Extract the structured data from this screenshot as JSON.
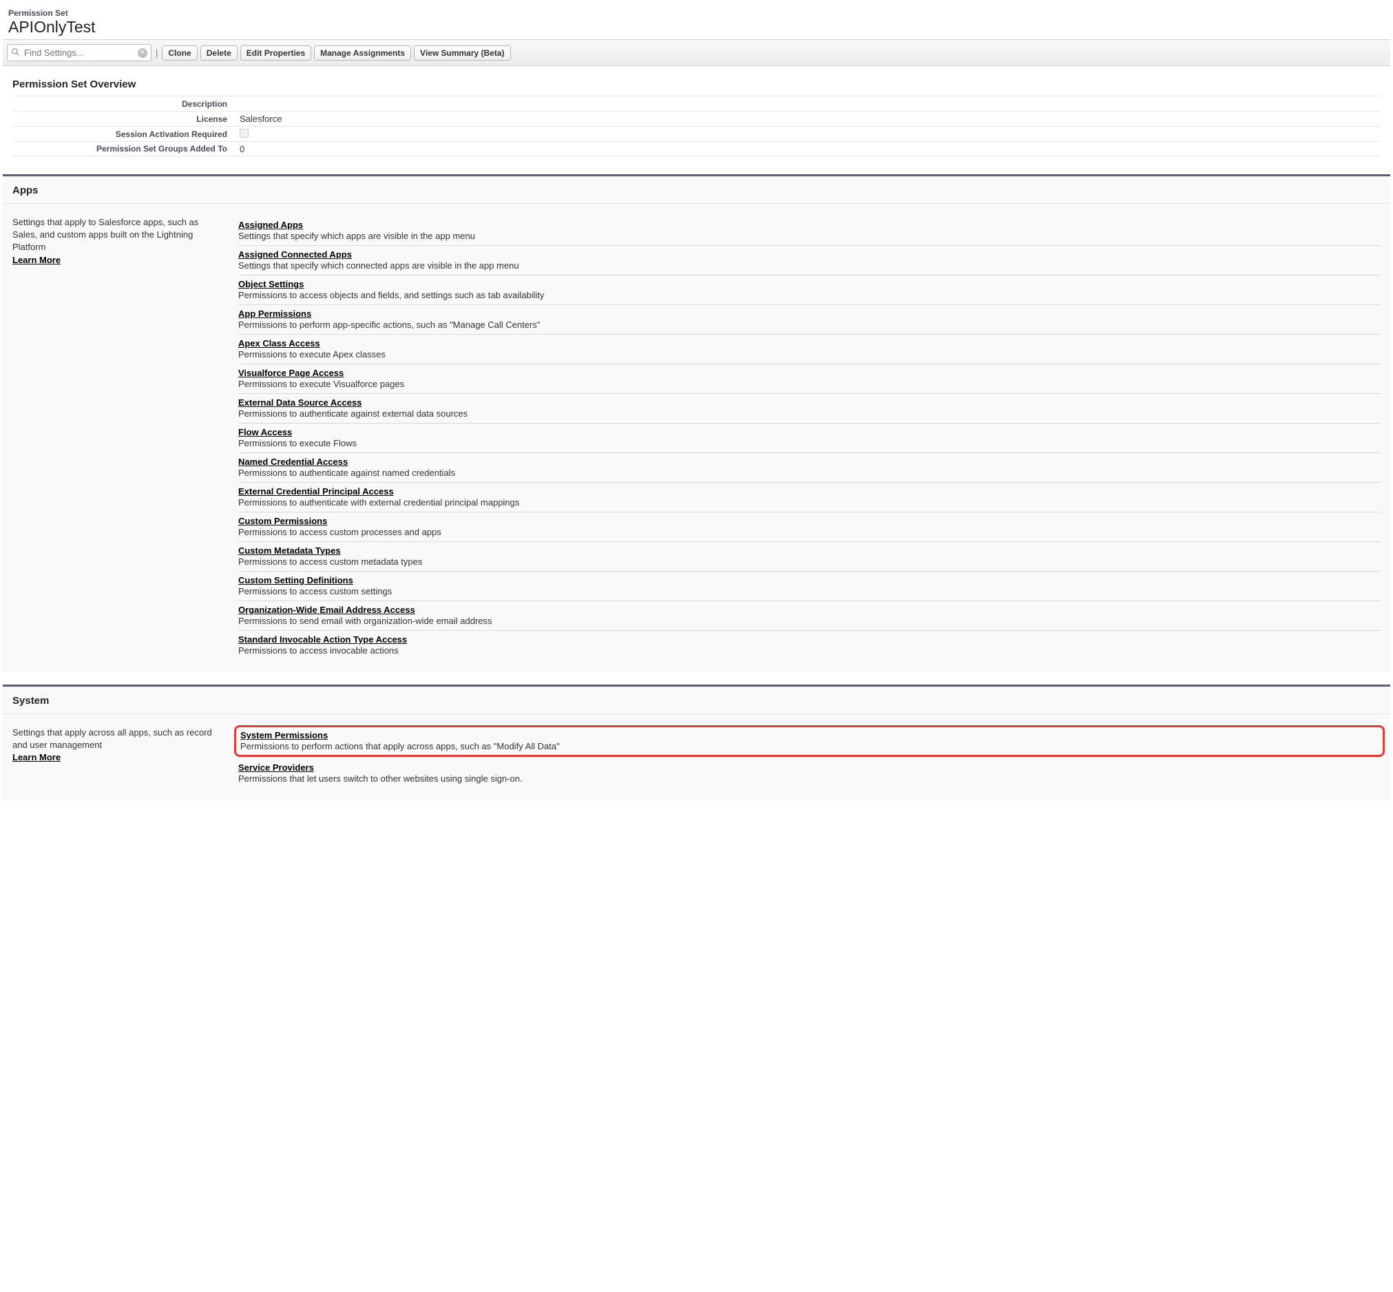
{
  "header": {
    "recordType": "Permission Set",
    "title": "APIOnlyTest"
  },
  "toolbar": {
    "searchPlaceholder": "Find Settings...",
    "buttons": {
      "clone": "Clone",
      "delete": "Delete",
      "editProperties": "Edit Properties",
      "manageAssignments": "Manage Assignments",
      "viewSummary": "View Summary (Beta)"
    }
  },
  "overview": {
    "heading": "Permission Set Overview",
    "fields": {
      "description": {
        "label": "Description",
        "value": ""
      },
      "license": {
        "label": "License",
        "value": "Salesforce"
      },
      "sessionActivation": {
        "label": "Session Activation Required"
      },
      "groupsAdded": {
        "label": "Permission Set Groups Added To",
        "value": "0"
      }
    }
  },
  "apps": {
    "heading": "Apps",
    "descriptionText": "Settings that apply to Salesforce apps, such as Sales, and custom apps built on the Lightning Platform",
    "learnMore": "Learn More",
    "links": [
      {
        "title": "Assigned Apps",
        "desc": "Settings that specify which apps are visible in the app menu"
      },
      {
        "title": "Assigned Connected Apps",
        "desc": "Settings that specify which connected apps are visible in the app menu"
      },
      {
        "title": "Object Settings",
        "desc": "Permissions to access objects and fields, and settings such as tab availability"
      },
      {
        "title": "App Permissions",
        "desc": "Permissions to perform app-specific actions, such as \"Manage Call Centers\""
      },
      {
        "title": "Apex Class Access",
        "desc": "Permissions to execute Apex classes"
      },
      {
        "title": "Visualforce Page Access",
        "desc": "Permissions to execute Visualforce pages"
      },
      {
        "title": "External Data Source Access",
        "desc": "Permissions to authenticate against external data sources"
      },
      {
        "title": "Flow Access",
        "desc": "Permissions to execute Flows"
      },
      {
        "title": "Named Credential Access",
        "desc": "Permissions to authenticate against named credentials"
      },
      {
        "title": "External Credential Principal Access",
        "desc": "Permissions to authenticate with external credential principal mappings"
      },
      {
        "title": "Custom Permissions",
        "desc": "Permissions to access custom processes and apps"
      },
      {
        "title": "Custom Metadata Types",
        "desc": "Permissions to access custom metadata types"
      },
      {
        "title": "Custom Setting Definitions",
        "desc": "Permissions to access custom settings"
      },
      {
        "title": "Organization-Wide Email Address Access",
        "desc": "Permissions to send email with organization-wide email address"
      },
      {
        "title": "Standard Invocable Action Type Access",
        "desc": "Permissions to access invocable actions"
      }
    ]
  },
  "system": {
    "heading": "System",
    "descriptionText": "Settings that apply across all apps, such as record and user management",
    "learnMore": "Learn More",
    "links": [
      {
        "title": "System Permissions",
        "desc": "Permissions to perform actions that apply across apps, such as \"Modify All Data\"",
        "highlighted": true
      },
      {
        "title": "Service Providers",
        "desc": "Permissions that let users switch to other websites using single sign-on."
      }
    ]
  }
}
